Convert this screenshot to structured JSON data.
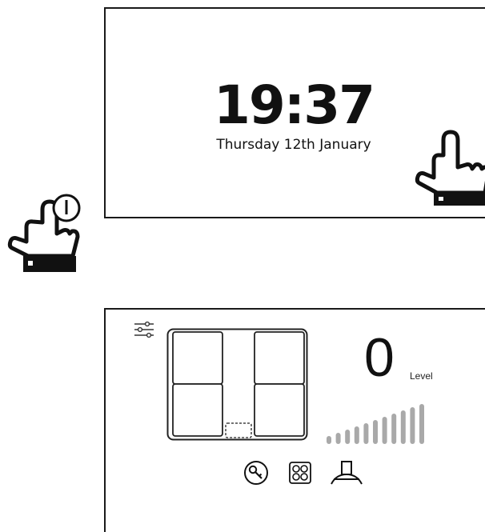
{
  "clock": {
    "time": "19:37",
    "date": "Thursday 12th January"
  },
  "hob_panel": {
    "extraction_level": "0",
    "level_label": "Level",
    "level_scale_steps": 11,
    "level_active_steps": 0,
    "bar_color": "#a9a9a9"
  },
  "icons": {
    "settings": "sliders-icon",
    "key": "key-icon",
    "zones": "cooking-zones-icon",
    "hood": "hood-icon",
    "swipe": "swipe-hand-icon",
    "power": "power-hand-icon"
  }
}
